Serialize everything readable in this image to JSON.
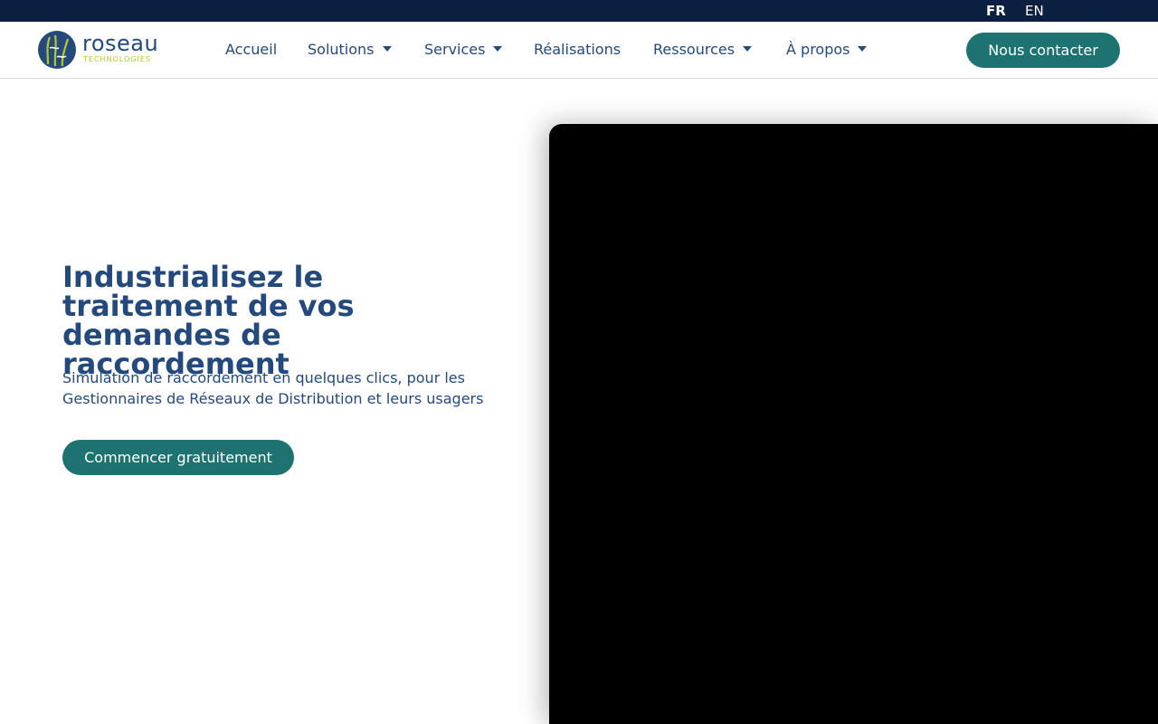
{
  "topbar": {
    "languages": [
      {
        "code": "FR",
        "active": true
      },
      {
        "code": "EN",
        "active": false
      }
    ]
  },
  "brand": {
    "name": "roseau",
    "tagline": "TECHNOLOGIES",
    "colors": {
      "primary": "#244a7d",
      "accent": "#b4c62a",
      "teal": "#1e7370",
      "topbar": "#0b2040"
    }
  },
  "nav": {
    "items": [
      {
        "label": "Accueil",
        "has_dropdown": false
      },
      {
        "label": "Solutions",
        "has_dropdown": true
      },
      {
        "label": "Services",
        "has_dropdown": true
      },
      {
        "label": "Réalisations",
        "has_dropdown": false
      },
      {
        "label": "Ressources",
        "has_dropdown": true
      },
      {
        "label": "À propos",
        "has_dropdown": true
      }
    ],
    "cta_label": "Nous contacter"
  },
  "hero": {
    "title": "Industrialisez le traitement de vos demandes de raccordement",
    "subtitle": "Simulation de raccordement en quelques clics, pour les Gestionnaires de Réseaux de Distribution et leurs usagers",
    "cta_label": "Commencer gratuitement"
  }
}
